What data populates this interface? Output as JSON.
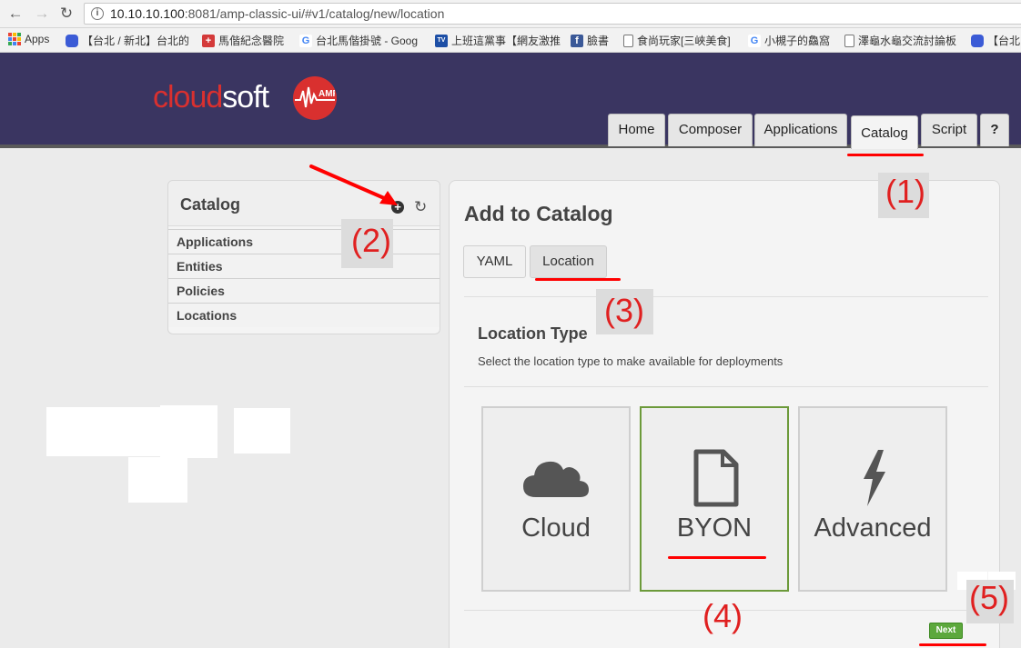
{
  "browser": {
    "url_host": "10.10.10.100",
    "url_rest": ":8081/amp-classic-ui/#v1/catalog/new/location",
    "bookmarks": [
      {
        "label": "Apps",
        "icon": "apps-grid-icon"
      },
      {
        "label": "【台北 / 新北】台北的",
        "icon": "chat-bubble-icon"
      },
      {
        "label": "馬偕紀念醫院",
        "icon": "hospital-cross-icon"
      },
      {
        "label": "台北馬偕掛號 - Goog",
        "icon": "google-icon"
      },
      {
        "label": "上班這黨事【網友激推",
        "icon": "tvbs-icon"
      },
      {
        "label": "臉書",
        "icon": "facebook-icon"
      },
      {
        "label": "食尚玩家[三峽美食]",
        "icon": "page-icon"
      },
      {
        "label": "小槻子的鱻窩",
        "icon": "google-icon"
      },
      {
        "label": "澤龜水龜交流討論板",
        "icon": "page-icon"
      },
      {
        "label": "【台北",
        "icon": "chat-bubble-icon"
      }
    ]
  },
  "header": {
    "logo_part1": "cloud",
    "logo_part2": "soft",
    "logo_badge_text": "AMP",
    "nav": [
      {
        "label": "Home"
      },
      {
        "label": "Composer"
      },
      {
        "label": "Applications"
      },
      {
        "label": "Catalog"
      },
      {
        "label": "Script"
      },
      {
        "label": "?"
      }
    ],
    "active_nav": "Catalog"
  },
  "sidebar": {
    "title": "Catalog",
    "items": [
      {
        "label": "Applications"
      },
      {
        "label": "Entities"
      },
      {
        "label": "Policies"
      },
      {
        "label": "Locations"
      }
    ]
  },
  "main": {
    "title": "Add to Catalog",
    "tabs": [
      {
        "label": "YAML"
      },
      {
        "label": "Location"
      }
    ],
    "active_tab": "Location",
    "section_title": "Location Type",
    "section_desc": "Select the location type to make available for deployments",
    "location_types": [
      {
        "label": "Cloud",
        "icon": "cloud-icon"
      },
      {
        "label": "BYON",
        "icon": "file-icon"
      },
      {
        "label": "Advanced",
        "icon": "lightning-bolt-icon"
      }
    ],
    "selected_type": "BYON",
    "next_label": "Next"
  },
  "annotations": {
    "steps": [
      "(1)",
      "(2)",
      "(3)",
      "(4)",
      "(5)"
    ],
    "color": "#e02020"
  }
}
